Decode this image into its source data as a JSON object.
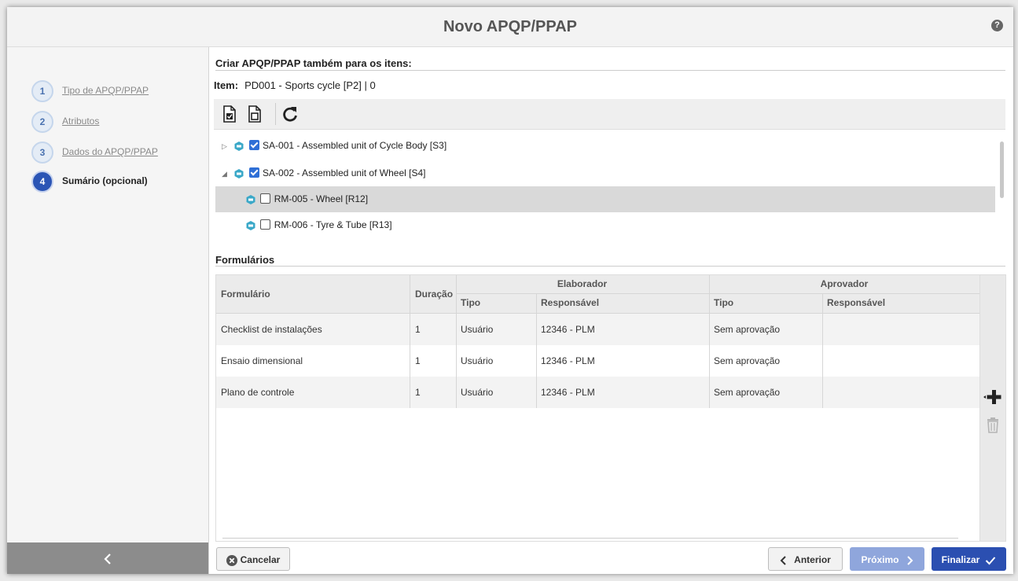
{
  "window": {
    "title": "Novo APQP/PPAP",
    "help_icon": "?"
  },
  "steps": [
    {
      "num": "1",
      "label": "Tipo de APQP/PPAP",
      "state": "done"
    },
    {
      "num": "2",
      "label": "Atributos",
      "state": "done"
    },
    {
      "num": "3",
      "label": "Dados do APQP/PPAP",
      "state": "done"
    },
    {
      "num": "4",
      "label": "Sumário (opcional)",
      "state": "active"
    }
  ],
  "sidebar": {
    "collapse_icon": "‹"
  },
  "items_section": {
    "title": "Criar APQP/PPAP também para os itens:",
    "item_label": "Item:",
    "item_value": "PD001 - Sports cycle [P2] | 0"
  },
  "tree": [
    {
      "label": "SA-001 - Assembled unit of Cycle Body [S3]",
      "checked": true,
      "expander": "▷",
      "level": 0
    },
    {
      "label": "SA-002 - Assembled unit of Wheel [S4]",
      "checked": true,
      "expander": "◢",
      "level": 0
    },
    {
      "label": "RM-005 - Wheel [R12]",
      "checked": false,
      "expander": "",
      "level": 1,
      "selected": true
    },
    {
      "label": "RM-006 - Tyre & Tube [R13]",
      "checked": false,
      "expander": "",
      "level": 1
    }
  ],
  "forms_section": {
    "title": "Formulários",
    "headers": {
      "formulario": "Formulário",
      "duracao": "Duração",
      "elaborador": "Elaborador",
      "aprovador": "Aprovador",
      "tipo": "Tipo",
      "responsavel": "Responsável"
    },
    "rows": [
      {
        "formulario": "Checklist de instalações",
        "duracao": "1",
        "elab_tipo": "Usuário",
        "elab_resp": "12346 - PLM",
        "aprov_tipo": "Sem aprovação",
        "aprov_resp": ""
      },
      {
        "formulario": "Ensaio dimensional",
        "duracao": "1",
        "elab_tipo": "Usuário",
        "elab_resp": "12346 - PLM",
        "aprov_tipo": "Sem aprovação",
        "aprov_resp": ""
      },
      {
        "formulario": "Plano de controle",
        "duracao": "1",
        "elab_tipo": "Usuário",
        "elab_resp": "12346 - PLM",
        "aprov_tipo": "Sem aprovação",
        "aprov_resp": ""
      }
    ]
  },
  "footer": {
    "cancel": "Cancelar",
    "previous": "Anterior",
    "next": "Próximo",
    "finish": "Finalizar"
  },
  "colors": {
    "primary": "#2b4fb1",
    "disabled": "#8fa6dc",
    "accent_checkbox": "#2f6fd6",
    "item_icon": "#3aa8c8"
  }
}
